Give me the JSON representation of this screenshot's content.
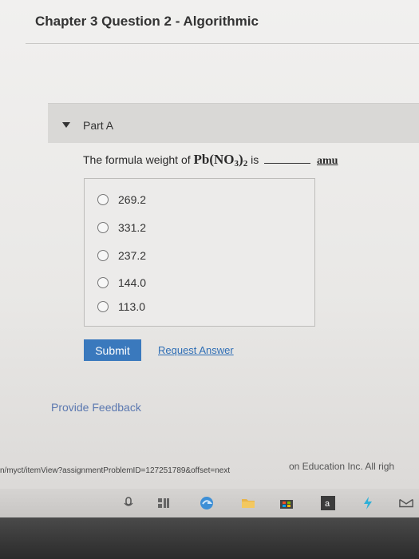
{
  "header": {
    "chapter_title": "Chapter 3 Question 2 - Algorithmic"
  },
  "part": {
    "label": "Part A"
  },
  "question": {
    "prefix": "The formula weight of",
    "formula_main": "Pb(NO",
    "formula_sub1": "3",
    "formula_close": ")",
    "formula_sub2": "2",
    "suffix": "is",
    "unit": "amu"
  },
  "choices": [
    "269.2",
    "331.2",
    "237.2",
    "144.0",
    "113.0"
  ],
  "actions": {
    "submit_label": "Submit",
    "request_answer_label": "Request Answer"
  },
  "feedback": {
    "label": "Provide Feedback"
  },
  "footer": {
    "status_url": "n/myct/itemView?assignmentProblemID=127251789&offset=next",
    "copyright_fragment": "on Education Inc. All righ"
  },
  "taskbar": {
    "icons": [
      "microphone-icon",
      "task-view-icon",
      "browser-icon",
      "folder-icon",
      "store-icon",
      "amazon-icon",
      "bolt-icon",
      "mail-icon"
    ]
  },
  "colors": {
    "submit_bg": "#3a79bd",
    "link": "#2f6eb5",
    "feedback_link": "#5b78b0"
  }
}
